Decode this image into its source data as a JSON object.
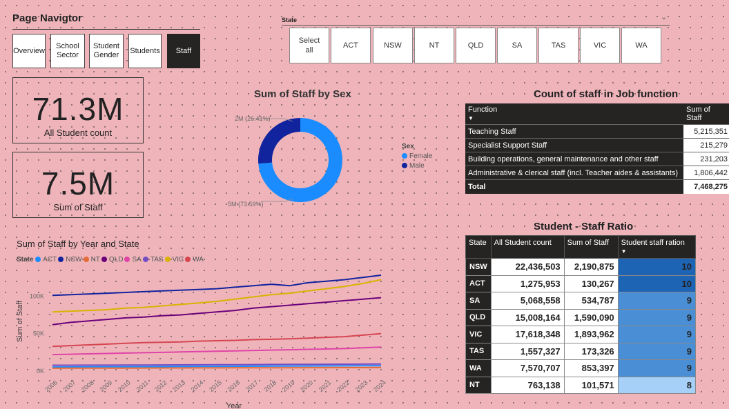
{
  "nav": {
    "title": "Page Navigtor",
    "buttons": [
      "Overview",
      "School\nSector",
      "Student\nGender",
      "Students",
      "Staff"
    ],
    "active": "Staff"
  },
  "state_slicer": {
    "label": "State",
    "options": [
      "Select\nall",
      "ACT",
      "NSW",
      "NT",
      "QLD",
      "SA",
      "TAS",
      "VIC",
      "WA"
    ]
  },
  "kpis": {
    "students_value": "71.3M",
    "students_label": "All Student count",
    "staff_value": "7.5M",
    "staff_label": "Sum of Staff"
  },
  "donut": {
    "title": "Sum of Staff by Sex",
    "legend_title": "Sex",
    "female_label": "Female",
    "male_label": "Male",
    "female_data_label": "5M (73.59%)",
    "male_data_label": "2M (26.41%)",
    "colors": {
      "female": "#1a8cff",
      "male": "#12239e"
    }
  },
  "job_table": {
    "title": "Count of staff in Job function",
    "headers": [
      "Function",
      "Sum of Staff"
    ],
    "rows": [
      [
        "Teaching Staff",
        "5,215,351"
      ],
      [
        "Specialist Support Staff",
        "215,279"
      ],
      [
        "Building operations, general maintenance and other staff",
        "231,203"
      ],
      [
        "Administrative & clerical staff (incl. Teacher aides & assistants)",
        "1,806,442"
      ]
    ],
    "total": [
      "Total",
      "7,468,275"
    ]
  },
  "ratio_table": {
    "title": "Student - Staff Ratio",
    "headers": [
      "State",
      "All Student count",
      "Sum of Staff",
      "Student staff ration"
    ],
    "rows": [
      [
        "NSW",
        "22,436,503",
        "2,190,875",
        "10"
      ],
      [
        "ACT",
        "1,275,953",
        "130,267",
        "10"
      ],
      [
        "SA",
        "5,068,558",
        "534,787",
        "9"
      ],
      [
        "QLD",
        "15,008,164",
        "1,590,090",
        "9"
      ],
      [
        "VIC",
        "17,618,348",
        "1,893,962",
        "9"
      ],
      [
        "TAS",
        "1,557,327",
        "173,326",
        "9"
      ],
      [
        "WA",
        "7,570,707",
        "853,397",
        "9"
      ],
      [
        "NT",
        "763,138",
        "101,571",
        "8"
      ]
    ]
  },
  "chart_data": [
    {
      "type": "pie",
      "title": "Sum of Staff by Sex",
      "legend_title": "Sex",
      "categories": [
        "Female",
        "Male"
      ],
      "values": [
        5496614,
        1971661
      ],
      "percent": [
        73.59,
        26.41
      ],
      "colors": [
        "#1a8cff",
        "#12239e"
      ]
    },
    {
      "type": "line",
      "title": "Sum of Staff by Year and State",
      "xlabel": "Year",
      "ylabel": "Sum of Staff",
      "legend_title": "State",
      "ylim": [
        0,
        140000
      ],
      "yticks": [
        "0K",
        "50K",
        "100K"
      ],
      "x": [
        2006,
        2007,
        2008,
        2009,
        2010,
        2011,
        2012,
        2013,
        2014,
        2015,
        2016,
        2017,
        2018,
        2019,
        2020,
        2021,
        2022,
        2023,
        2024
      ],
      "series": [
        {
          "name": "ACT",
          "color": "#1a8cff",
          "values": [
            5400,
            5500,
            5600,
            5700,
            5800,
            5900,
            6000,
            6100,
            6200,
            6300,
            6400,
            6500,
            6600,
            6700,
            6800,
            6900,
            7000,
            7100,
            7200
          ]
        },
        {
          "name": "NSW",
          "color": "#12239e",
          "values": [
            101000,
            102000,
            103000,
            104000,
            105000,
            106000,
            107000,
            108000,
            109000,
            110000,
            112000,
            114000,
            116000,
            114000,
            118000,
            120000,
            122000,
            125000,
            128000
          ]
        },
        {
          "name": "NT",
          "color": "#e66c37",
          "values": [
            3800,
            3850,
            3900,
            3950,
            4000,
            4050,
            4100,
            4150,
            4200,
            4250,
            4300,
            4350,
            4400,
            4450,
            4500,
            4550,
            4600,
            4650,
            4700
          ]
        },
        {
          "name": "QLD",
          "color": "#6b007b",
          "values": [
            62000,
            65000,
            67000,
            69000,
            71000,
            72000,
            74000,
            75000,
            77000,
            79000,
            81000,
            84000,
            86000,
            88000,
            90000,
            92000,
            94000,
            96000,
            98000
          ]
        },
        {
          "name": "SA",
          "color": "#e044a7",
          "values": [
            22000,
            22500,
            23000,
            23500,
            24000,
            24500,
            25000,
            25500,
            26000,
            26500,
            27000,
            27500,
            28000,
            28500,
            29000,
            29500,
            30000,
            31000,
            32000
          ]
        },
        {
          "name": "TAS",
          "color": "#744ec2",
          "values": [
            7800,
            7850,
            7900,
            7950,
            8000,
            8100,
            8200,
            8300,
            8400,
            8500,
            8600,
            8700,
            8800,
            8900,
            9000,
            9100,
            9200,
            9300,
            9400
          ]
        },
        {
          "name": "VIC",
          "color": "#d9b300",
          "values": [
            79000,
            80000,
            81000,
            82000,
            84000,
            85000,
            87000,
            89000,
            91000,
            93000,
            96000,
            99000,
            102000,
            104000,
            107000,
            110000,
            113000,
            117000,
            122000
          ]
        },
        {
          "name": "WA",
          "color": "#d64550",
          "values": [
            33000,
            34000,
            35000,
            36000,
            37000,
            38000,
            38500,
            39000,
            40000,
            40500,
            41000,
            42000,
            42500,
            43000,
            44000,
            45000,
            46000,
            48000,
            50000
          ]
        }
      ]
    }
  ]
}
